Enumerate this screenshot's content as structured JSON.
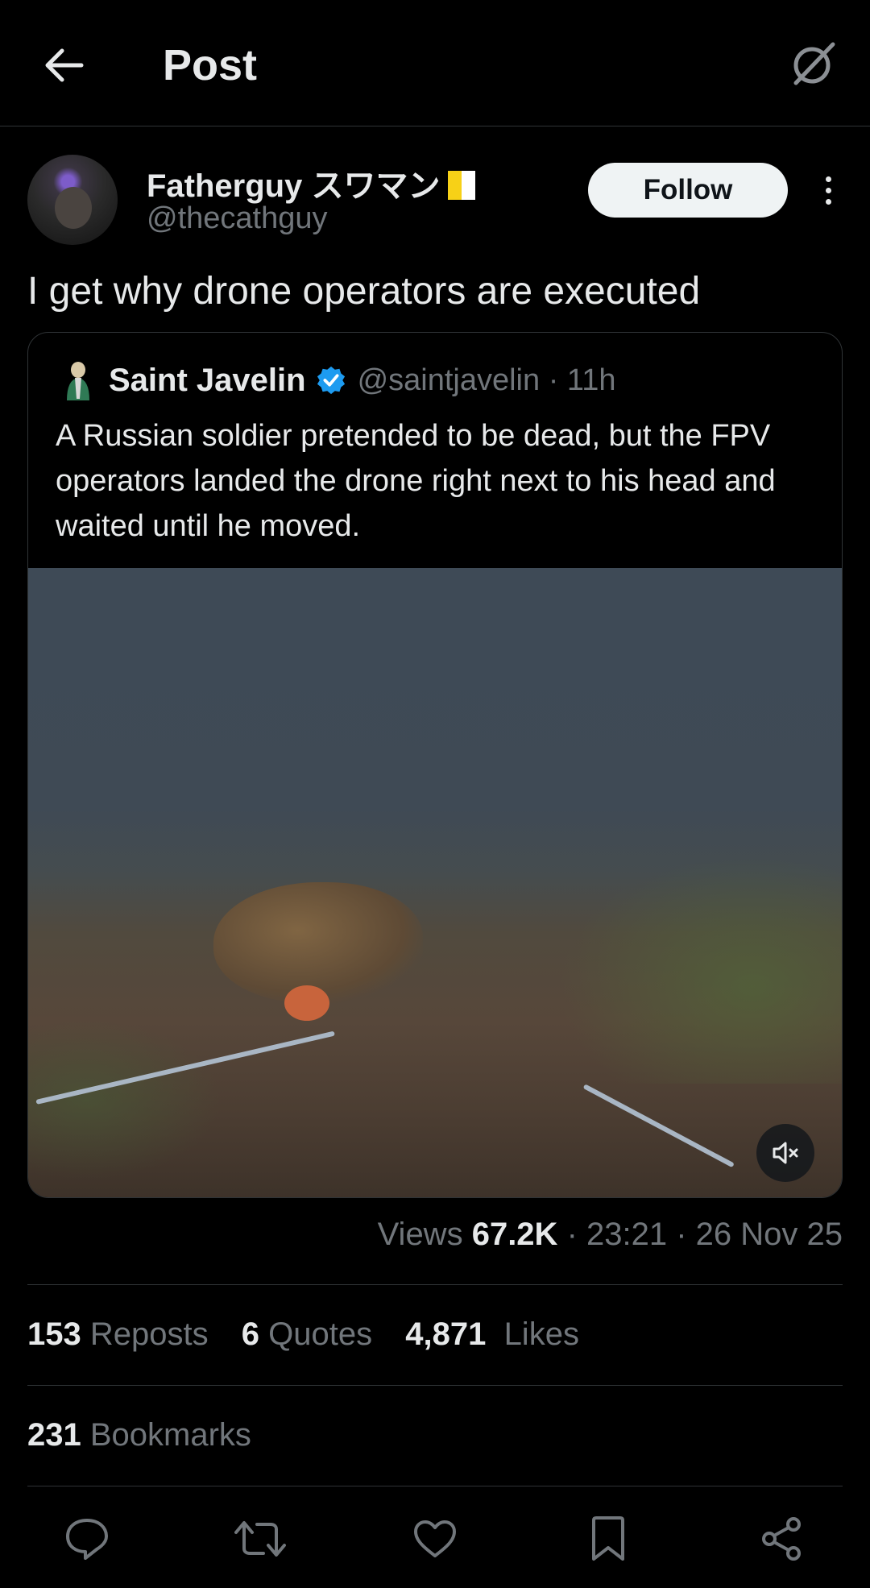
{
  "header": {
    "title": "Post"
  },
  "post": {
    "author_name": "Fatherguy スワマン",
    "author_handle": "@thecathguy",
    "follow_label": "Follow",
    "text": "I get why drone operators are executed"
  },
  "quoted": {
    "name": "Saint Javelin",
    "handle_time": "@saintjavelin · 11h",
    "text": "A Russian soldier pretended to be dead, but the FPV operators landed the drone right next to his head and waited until he moved."
  },
  "meta": {
    "views_label": "Views",
    "views_value": "67.2K",
    "time": "· 23:21 · 26 Nov 25"
  },
  "stats": {
    "reposts_count": "153",
    "reposts_label": "Reposts",
    "quotes_count": "6",
    "quotes_label": "Quotes",
    "likes_count": "4,871",
    "likes_label": "Likes",
    "bookmarks_count": "231",
    "bookmarks_label": "Bookmarks"
  },
  "icons": [
    "back-arrow-icon",
    "grok-icon",
    "more-icon",
    "verified-badge-icon",
    "mute-icon",
    "reply-icon",
    "repost-icon",
    "like-icon",
    "bookmark-icon",
    "share-icon"
  ],
  "colors": {
    "background": "#000000",
    "text": "#e7e9ea",
    "muted": "#71767b",
    "verified": "#1d9bf0",
    "border": "#2f3336"
  }
}
